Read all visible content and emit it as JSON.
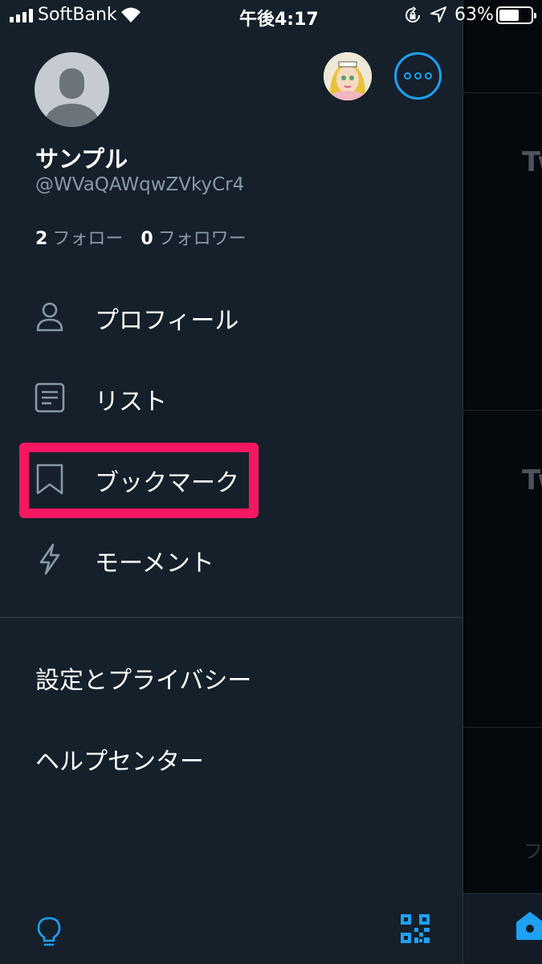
{
  "status_bar": {
    "carrier": "SoftBank",
    "time": "午後4:17",
    "battery_percent": "63%",
    "battery_level": 0.63
  },
  "profile": {
    "display_name": "サンプル",
    "handle": "@WVaQAWqwZVkyCr4",
    "following_count": "2",
    "following_label": "フォロー",
    "followers_count": "0",
    "followers_label": "フォロワー"
  },
  "menu": {
    "items": [
      {
        "label": "プロフィール",
        "icon": "person-icon"
      },
      {
        "label": "リスト",
        "icon": "list-icon"
      },
      {
        "label": "ブックマーク",
        "icon": "bookmark-icon"
      },
      {
        "label": "モーメント",
        "icon": "lightning-icon"
      }
    ],
    "highlighted": "ブックマーク"
  },
  "secondary_menu": {
    "settings_label": "設定とプライバシー",
    "help_label": "ヘルプセンター"
  },
  "background": {
    "partial_text_1": "Tw",
    "partial_text_2": "Tw",
    "partial_text_3": "フ"
  },
  "colors": {
    "drawer_bg": "#15202b",
    "accent": "#1da1f2",
    "highlight": "#f5175f",
    "secondary_text": "#8899a6"
  }
}
